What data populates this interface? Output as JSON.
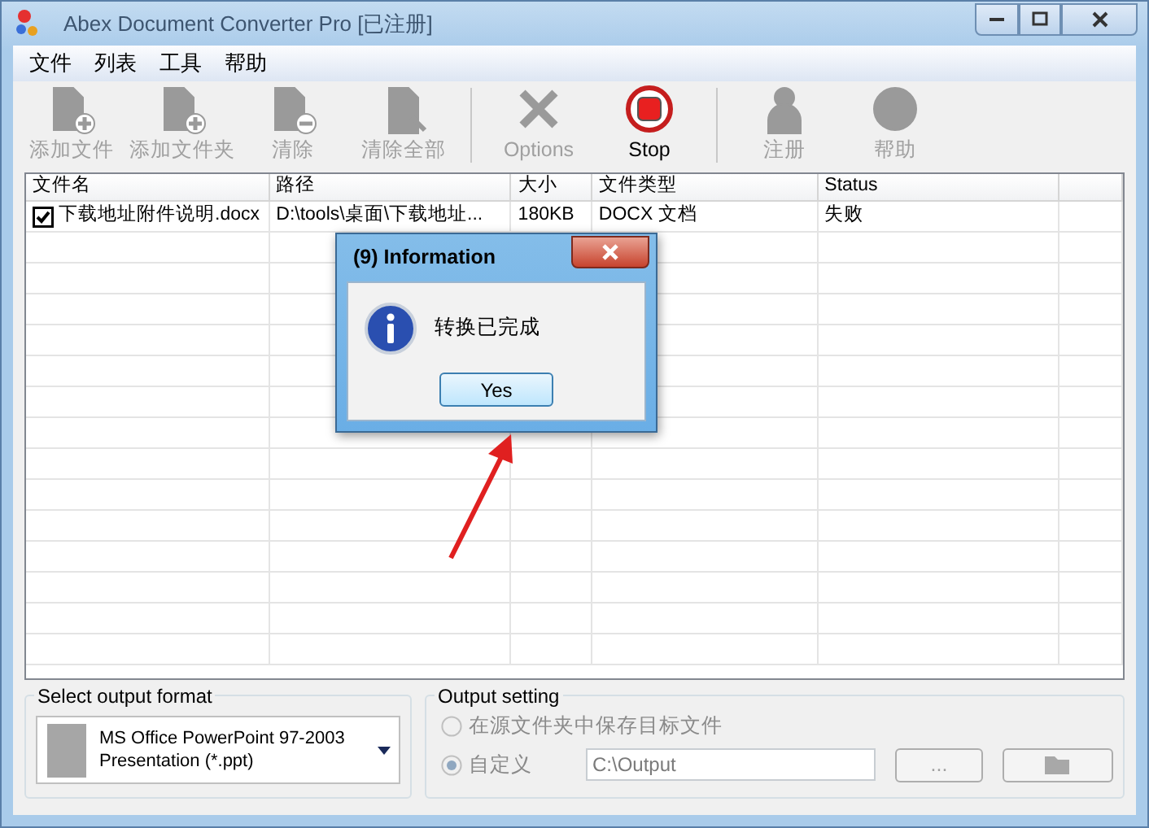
{
  "window": {
    "title": "Abex Document Converter Pro [已注册]"
  },
  "menu": [
    {
      "label": "文件"
    },
    {
      "label": "列表"
    },
    {
      "label": "工具"
    },
    {
      "label": "帮助"
    }
  ],
  "toolbar_groups": [
    {
      "buttons": [
        {
          "kind": "add-file",
          "label": "添加文件",
          "disabled": true
        },
        {
          "kind": "add-folder",
          "label": "添加文件夹",
          "disabled": true
        },
        {
          "kind": "remove",
          "label": "清除",
          "disabled": true
        },
        {
          "kind": "remove-all",
          "label": "清除全部",
          "disabled": true
        }
      ]
    },
    {
      "buttons": [
        {
          "kind": "options",
          "label": "Options",
          "disabled": true
        },
        {
          "kind": "stop",
          "label": "Stop",
          "disabled": false
        }
      ]
    },
    {
      "buttons": [
        {
          "kind": "register",
          "label": "注册",
          "disabled": true
        },
        {
          "kind": "help",
          "label": "帮助",
          "disabled": true
        }
      ]
    }
  ],
  "table": {
    "columns": [
      "文件名",
      "路径",
      "大小",
      "文件类型",
      "Status"
    ],
    "rows": [
      {
        "checked": true,
        "cells": [
          "下载地址附件说明.docx",
          "D:\\tools\\桌面\\下载地址...",
          "180KB",
          "DOCX 文档",
          "失败"
        ]
      }
    ]
  },
  "dialog": {
    "title": "(9)  Information",
    "message": "转换已完成",
    "button": "Yes"
  },
  "output_format": {
    "label": "Select output format",
    "value": [
      "MS Office PowerPoint 97-2003",
      "Presentation (*.ppt)"
    ]
  },
  "output_setting": {
    "label": "Output setting",
    "options": [
      {
        "label": "在源文件夹中保存目标文件",
        "selected": false,
        "disabled": true
      },
      {
        "label": "自定义",
        "selected": true,
        "disabled": true
      }
    ],
    "path": "C:\\Output",
    "browse_button": "...",
    "path_disabled": true
  }
}
